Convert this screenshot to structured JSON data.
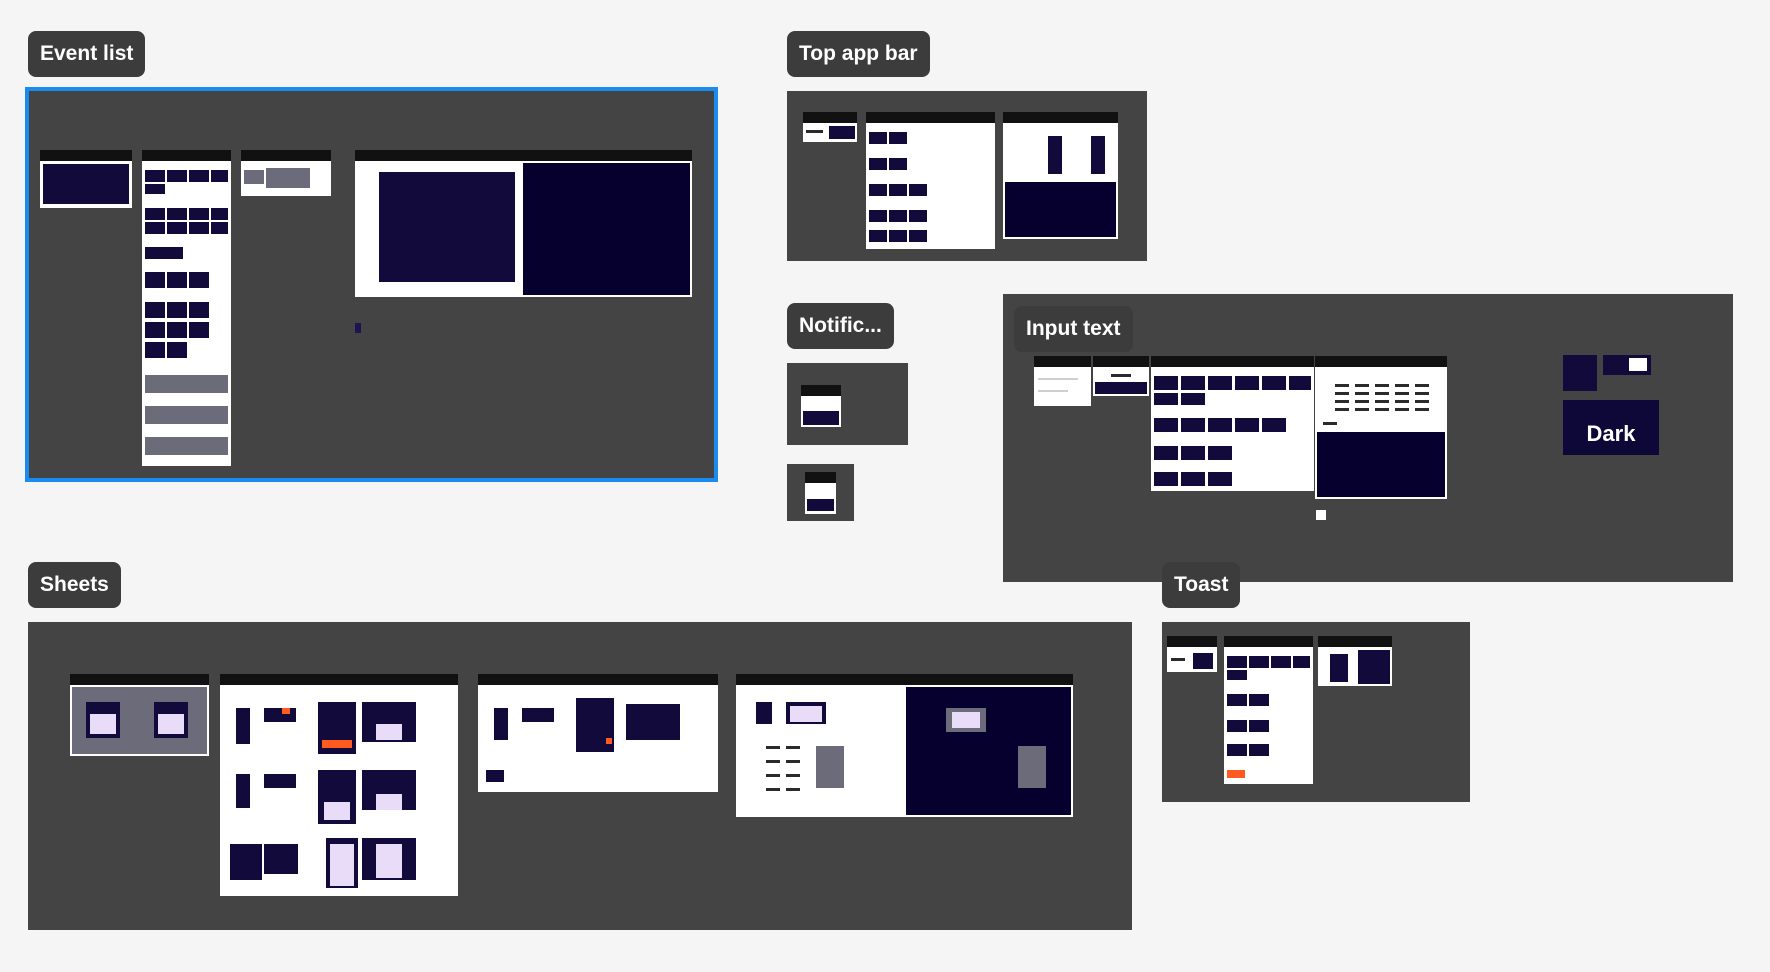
{
  "sections": {
    "event_list": {
      "label": "Event list"
    },
    "top_app_bar": {
      "label": "Top app bar"
    },
    "notifications": {
      "label": "Notific..."
    },
    "input_text": {
      "label": "Input text",
      "dark_badge": "Dark"
    },
    "sheets": {
      "label": "Sheets"
    },
    "toast": {
      "label": "Toast"
    }
  },
  "colors": {
    "canvas": "#f5f5f5",
    "section": "#444444",
    "label": "#3c3c3c",
    "selection": "#1a8cf0",
    "navy": "#05002e"
  }
}
